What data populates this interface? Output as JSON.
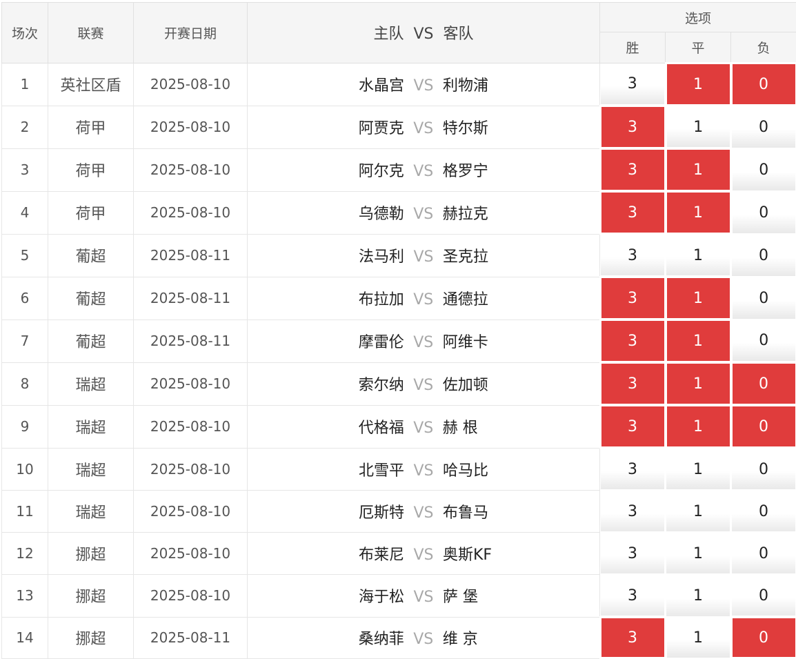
{
  "header": {
    "col_index": "场次",
    "col_league": "联赛",
    "col_date": "开赛日期",
    "col_match": "主队  VS  客队",
    "options_group": "选项",
    "opt_win": "胜",
    "opt_draw": "平",
    "opt_lose": "负"
  },
  "colors": {
    "selected": "#e03c3c",
    "header_bg": "#f5f5f5",
    "vs": "#a8a8a8"
  },
  "rows": [
    {
      "no": "1",
      "league": "英社区盾",
      "date": "2025-08-10",
      "home": "水晶宫",
      "vs": "VS",
      "away": "利物浦",
      "opts": [
        "3",
        "1",
        "0"
      ],
      "sel": [
        false,
        true,
        true
      ]
    },
    {
      "no": "2",
      "league": "荷甲",
      "date": "2025-08-10",
      "home": "阿贾克",
      "vs": "VS",
      "away": "特尔斯",
      "opts": [
        "3",
        "1",
        "0"
      ],
      "sel": [
        true,
        false,
        false
      ]
    },
    {
      "no": "3",
      "league": "荷甲",
      "date": "2025-08-10",
      "home": "阿尔克",
      "vs": "VS",
      "away": "格罗宁",
      "opts": [
        "3",
        "1",
        "0"
      ],
      "sel": [
        true,
        true,
        false
      ]
    },
    {
      "no": "4",
      "league": "荷甲",
      "date": "2025-08-10",
      "home": "乌德勒",
      "vs": "VS",
      "away": "赫拉克",
      "opts": [
        "3",
        "1",
        "0"
      ],
      "sel": [
        true,
        true,
        false
      ]
    },
    {
      "no": "5",
      "league": "葡超",
      "date": "2025-08-11",
      "home": "法马利",
      "vs": "VS",
      "away": "圣克拉",
      "opts": [
        "3",
        "1",
        "0"
      ],
      "sel": [
        false,
        false,
        false
      ]
    },
    {
      "no": "6",
      "league": "葡超",
      "date": "2025-08-11",
      "home": "布拉加",
      "vs": "VS",
      "away": "通德拉",
      "opts": [
        "3",
        "1",
        "0"
      ],
      "sel": [
        true,
        true,
        false
      ]
    },
    {
      "no": "7",
      "league": "葡超",
      "date": "2025-08-11",
      "home": "摩雷伦",
      "vs": "VS",
      "away": "阿维卡",
      "opts": [
        "3",
        "1",
        "0"
      ],
      "sel": [
        true,
        true,
        false
      ]
    },
    {
      "no": "8",
      "league": "瑞超",
      "date": "2025-08-10",
      "home": "索尔纳",
      "vs": "VS",
      "away": "佐加顿",
      "opts": [
        "3",
        "1",
        "0"
      ],
      "sel": [
        true,
        true,
        true
      ]
    },
    {
      "no": "9",
      "league": "瑞超",
      "date": "2025-08-10",
      "home": "代格福",
      "vs": "VS",
      "away": "赫 根",
      "opts": [
        "3",
        "1",
        "0"
      ],
      "sel": [
        true,
        true,
        true
      ]
    },
    {
      "no": "10",
      "league": "瑞超",
      "date": "2025-08-10",
      "home": "北雪平",
      "vs": "VS",
      "away": "哈马比",
      "opts": [
        "3",
        "1",
        "0"
      ],
      "sel": [
        false,
        false,
        false
      ]
    },
    {
      "no": "11",
      "league": "瑞超",
      "date": "2025-08-10",
      "home": "厄斯特",
      "vs": "VS",
      "away": "布鲁马",
      "opts": [
        "3",
        "1",
        "0"
      ],
      "sel": [
        false,
        false,
        false
      ]
    },
    {
      "no": "12",
      "league": "挪超",
      "date": "2025-08-10",
      "home": "布莱尼",
      "vs": "VS",
      "away": "奥斯KF",
      "opts": [
        "3",
        "1",
        "0"
      ],
      "sel": [
        false,
        false,
        false
      ]
    },
    {
      "no": "13",
      "league": "挪超",
      "date": "2025-08-10",
      "home": "海于松",
      "vs": "VS",
      "away": "萨 堡",
      "opts": [
        "3",
        "1",
        "0"
      ],
      "sel": [
        false,
        false,
        false
      ]
    },
    {
      "no": "14",
      "league": "挪超",
      "date": "2025-08-11",
      "home": "桑纳菲",
      "vs": "VS",
      "away": "维 京",
      "opts": [
        "3",
        "1",
        "0"
      ],
      "sel": [
        true,
        false,
        true
      ]
    }
  ]
}
